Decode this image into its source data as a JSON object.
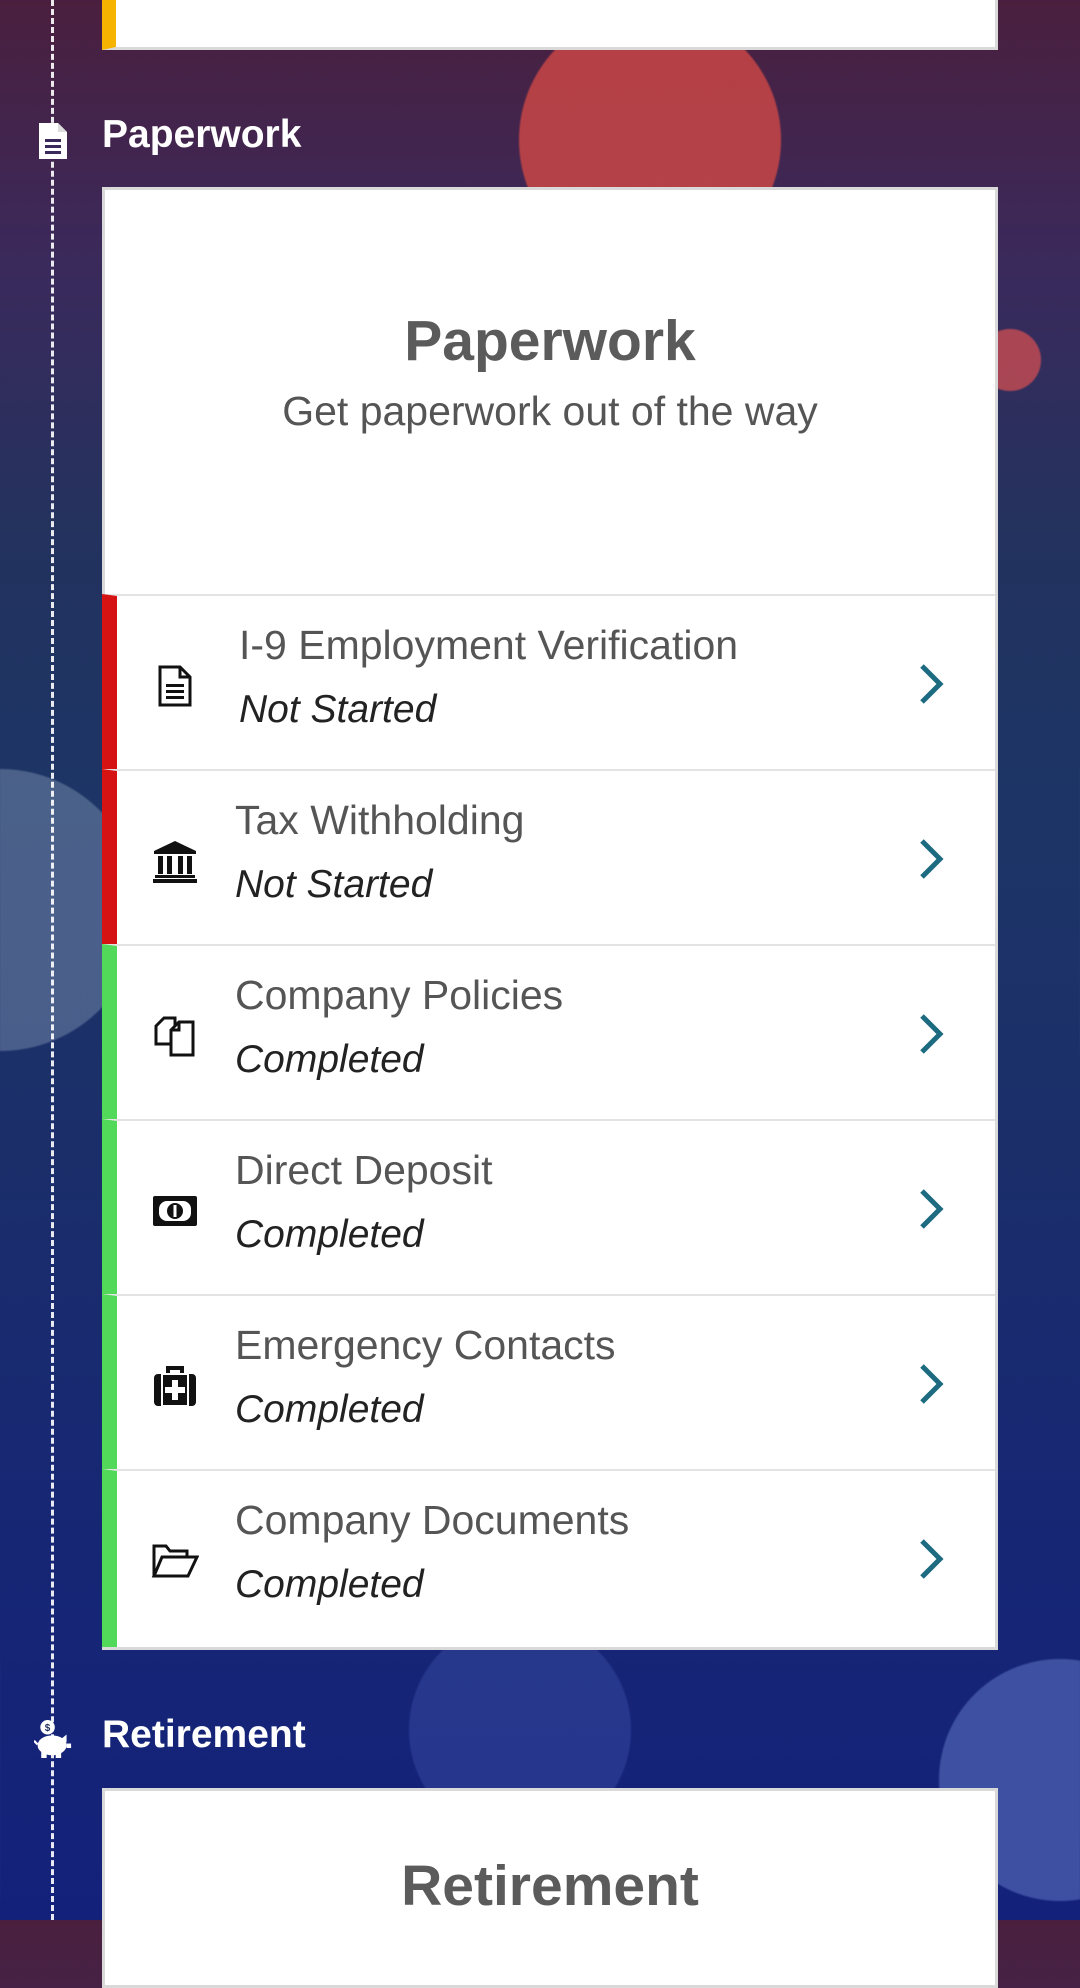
{
  "sections": {
    "paperwork_label": "Paperwork",
    "retirement_label": "Retirement"
  },
  "paperwork_card": {
    "title": "Paperwork",
    "subtitle": "Get paperwork out of the way",
    "tasks": [
      {
        "title": "I-9 Employment Verification",
        "status": "Not Started",
        "icon": "document-icon",
        "status_color": "#d51313"
      },
      {
        "title": "Tax Withholding",
        "status": "Not Started",
        "icon": "bank-icon",
        "status_color": "#d51313"
      },
      {
        "title": "Company Policies",
        "status": "Completed",
        "icon": "copy-icon",
        "status_color": "#52d95a"
      },
      {
        "title": "Direct Deposit",
        "status": "Completed",
        "icon": "money-icon",
        "status_color": "#52d95a"
      },
      {
        "title": "Emergency Contacts",
        "status": "Completed",
        "icon": "medical-kit-icon",
        "status_color": "#52d95a"
      },
      {
        "title": "Company Documents",
        "status": "Completed",
        "icon": "folder-open-icon",
        "status_color": "#52d95a"
      }
    ]
  },
  "retirement_card": {
    "title": "Retirement"
  },
  "colors": {
    "chevron": "#1d6b80",
    "pending": "#d51313",
    "completed": "#52d95a",
    "previous_section": "#f6b400"
  }
}
